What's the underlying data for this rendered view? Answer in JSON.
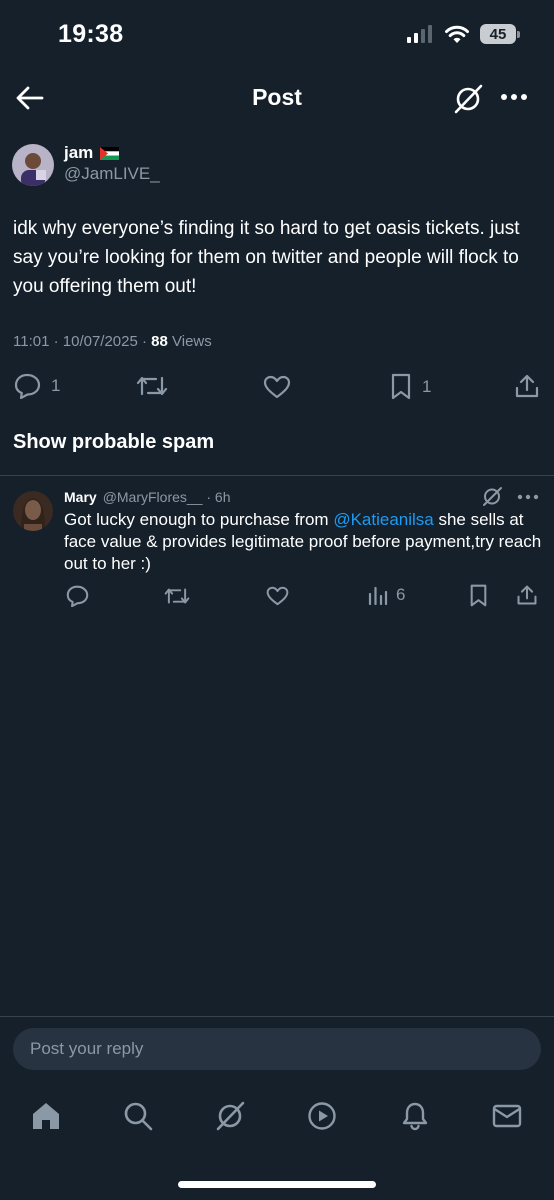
{
  "status_bar": {
    "time": "19:38",
    "battery": "45"
  },
  "header": {
    "title": "Post"
  },
  "post": {
    "author_name": "jam",
    "author_handle": "@JamLIVE_",
    "text": "idk why everyone’s finding it so hard to get oasis tickets. just say you’re looking for them on twitter and people will flock to you offering them out!",
    "timestamp": "11:01 · 10/07/2025 · ",
    "views_count": "88",
    "views_label": " Views",
    "reply_count": "1",
    "bookmark_count": "1"
  },
  "spam_toggle": {
    "label": "Show probable spam"
  },
  "reply": {
    "author_name": "Mary",
    "author_handle": "@MaryFlores__",
    "time": " · 6h",
    "text_before": "Got lucky enough to purchase from ",
    "mention": "@Katieanilsa",
    "text_after": " she sells at face value & provides legitimate proof before payment,try reach out to her :)",
    "views_count": "6"
  },
  "composer": {
    "placeholder": "Post your reply"
  },
  "colors": {
    "background": "#15202b",
    "accent": "#1d9bf0",
    "muted": "#8b98a5",
    "divider": "#38444d"
  }
}
